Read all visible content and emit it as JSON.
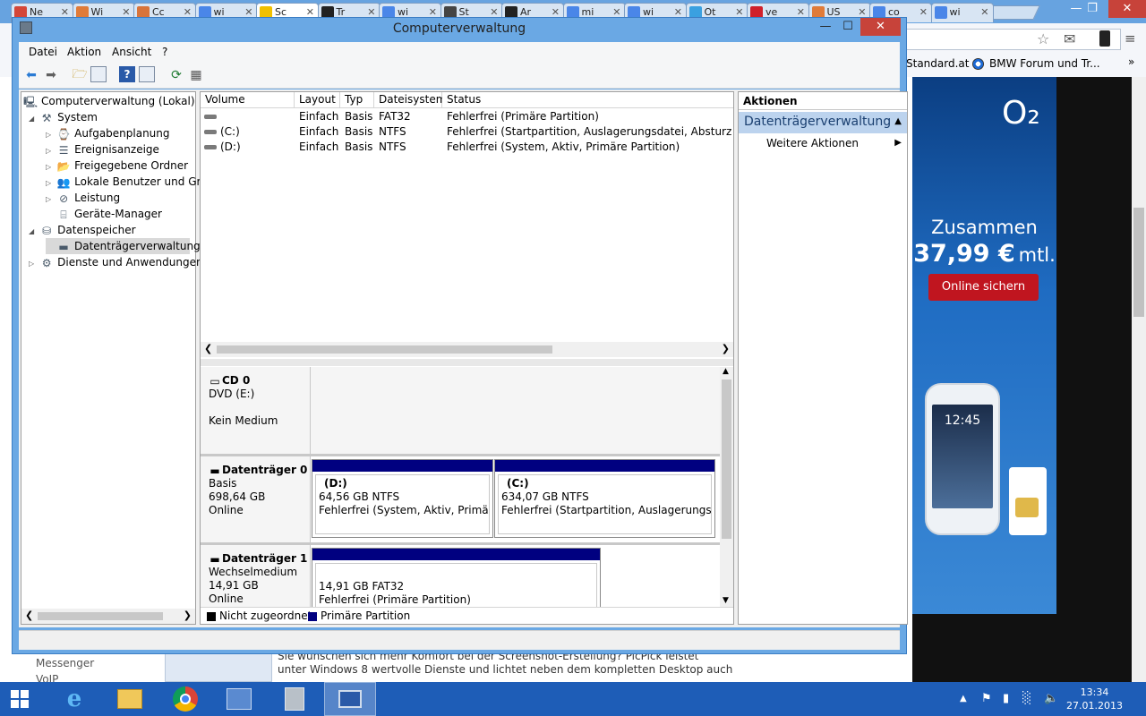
{
  "browser": {
    "tabs": [
      {
        "label": "Ne",
        "color": "#d44638"
      },
      {
        "label": "Wi",
        "color": "#e07b39"
      },
      {
        "label": "Cc",
        "color": "#d9743a"
      },
      {
        "label": "wi",
        "color": "#4a86e8"
      },
      {
        "label": "Sc",
        "color": "#f0c000",
        "active": true
      },
      {
        "label": "Tr",
        "color": "#222222"
      },
      {
        "label": "wi",
        "color": "#4a86e8"
      },
      {
        "label": "St",
        "color": "#444444"
      },
      {
        "label": "Ar",
        "color": "#222222"
      },
      {
        "label": "mi",
        "color": "#4a86e8"
      },
      {
        "label": "wi",
        "color": "#4a86e8"
      },
      {
        "label": "Ot",
        "color": "#3aa0e0"
      },
      {
        "label": "ve",
        "color": "#d0202a"
      },
      {
        "label": "US",
        "color": "#e07b39"
      },
      {
        "label": "co",
        "color": "#4a86e8"
      },
      {
        "label": "wi",
        "color": "#4a86e8"
      }
    ],
    "bookmarks": [
      "Standard.at",
      "BMW Forum und Tr..."
    ]
  },
  "ad": {
    "brand": "O₂",
    "line1": "Zusammen",
    "price": "37,99 €",
    "price_suffix": "mtl.",
    "button": "Online sichern",
    "phone_time": "12:45"
  },
  "behind_page": {
    "sidebar_items": [
      "Messenger",
      "VoIP"
    ],
    "text_line1": "Sie wünschen sich mehr Komfort bei der Screenshot-Erstellung? PicPick leistet",
    "text_line2": "unter Windows 8 wertvolle Dienste und lichtet neben dem kompletten Desktop auch"
  },
  "window": {
    "title": "Computerverwaltung",
    "menus": [
      "Datei",
      "Aktion",
      "Ansicht",
      "?"
    ]
  },
  "tree": [
    {
      "label": "Computerverwaltung (Lokal)",
      "level": 0,
      "arrow": "",
      "icon": "computer-icon"
    },
    {
      "label": "System",
      "level": 1,
      "arrow": "◢",
      "icon": "tools-icon"
    },
    {
      "label": "Aufgabenplanung",
      "level": 2,
      "arrow": "▷",
      "icon": "clock-icon"
    },
    {
      "label": "Ereignisanzeige",
      "level": 2,
      "arrow": "▷",
      "icon": "event-viewer-icon"
    },
    {
      "label": "Freigegebene Ordner",
      "level": 2,
      "arrow": "▷",
      "icon": "shared-folder-icon"
    },
    {
      "label": "Lokale Benutzer und Gruppen",
      "level": 2,
      "arrow": "▷",
      "icon": "users-icon"
    },
    {
      "label": "Leistung",
      "level": 2,
      "arrow": "▷",
      "icon": "performance-icon"
    },
    {
      "label": "Geräte-Manager",
      "level": 2,
      "arrow": "",
      "icon": "device-manager-icon"
    },
    {
      "label": "Datenspeicher",
      "level": 1,
      "arrow": "◢",
      "icon": "storage-icon"
    },
    {
      "label": "Datenträgerverwaltung",
      "level": 2,
      "arrow": "",
      "icon": "disk-management-icon",
      "selected": true
    },
    {
      "label": "Dienste und Anwendungen",
      "level": 1,
      "arrow": "▷",
      "icon": "services-icon"
    }
  ],
  "volumes": {
    "headers": [
      "Volume",
      "Layout",
      "Typ",
      "Dateisystem",
      "Status"
    ],
    "rows": [
      {
        "volume": "",
        "layout": "Einfach",
        "typ": "Basis",
        "fs": "FAT32",
        "status": "Fehlerfrei (Primäre Partition)"
      },
      {
        "volume": "(C:)",
        "layout": "Einfach",
        "typ": "Basis",
        "fs": "NTFS",
        "status": "Fehlerfrei (Startpartition, Auslagerungsdatei, Absturzabbild, P"
      },
      {
        "volume": "(D:)",
        "layout": "Einfach",
        "typ": "Basis",
        "fs": "NTFS",
        "status": "Fehlerfrei (System, Aktiv, Primäre Partition)"
      }
    ]
  },
  "disks": {
    "cd0": {
      "name": "CD 0",
      "type": "DVD (E:)",
      "status": "Kein Medium"
    },
    "disk0": {
      "name": "Datenträger 0",
      "type": "Basis",
      "size": "698,64 GB",
      "state": "Online",
      "partitions": [
        {
          "label": "(D:)",
          "size": "64,56 GB NTFS",
          "status": "Fehlerfrei (System, Aktiv, Primäre Partition)"
        },
        {
          "label": "(C:)",
          "size": "634,07 GB NTFS",
          "status": "Fehlerfrei (Startpartition, Auslagerungsdatei, Absturzabbild, Primäre Partition)"
        }
      ]
    },
    "disk1": {
      "name": "Datenträger 1",
      "type": "Wechselmedium",
      "size": "14,91 GB",
      "state": "Online",
      "partitions": [
        {
          "label": "",
          "size": "14,91 GB FAT32",
          "status": "Fehlerfrei (Primäre Partition)"
        }
      ]
    }
  },
  "legend": [
    {
      "label": "Nicht zugeordnet",
      "color": "#000000"
    },
    {
      "label": "Primäre Partition",
      "color": "#000080"
    }
  ],
  "actions": {
    "header": "Aktionen",
    "section": "Datenträgerverwaltung",
    "more": "Weitere Aktionen"
  },
  "taskbar": {
    "time": "13:34",
    "date": "27.01.2013"
  }
}
